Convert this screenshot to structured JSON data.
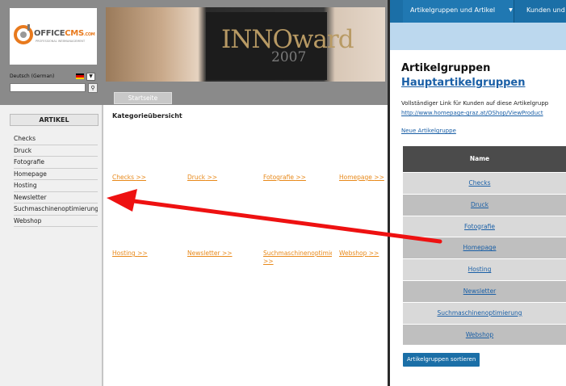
{
  "logo": {
    "brand": "OFFICE",
    "brand_accent": "CMS",
    "suffix": ".COM",
    "tagline": "PROFESSIONAL WEBMANAGEMENT"
  },
  "language": {
    "label": "Deutsch (German)",
    "dropdown_icon": "chevron-down-icon",
    "flag_colors": [
      "#000000",
      "#dd0000",
      "#ffce00"
    ]
  },
  "search": {
    "placeholder": "",
    "button_icon": "search-icon"
  },
  "banner": {
    "text": "INNOward",
    "year": "2007"
  },
  "home_tab": "Startseite",
  "sidebar": {
    "header": "ARTIKEL",
    "items": [
      "Checks",
      "Druck",
      "Fotografie",
      "Homepage",
      "Hosting",
      "Newsletter",
      "Suchmaschinenoptimierung",
      "Webshop"
    ]
  },
  "content": {
    "heading": "Kategorieübersicht",
    "arrow": ">>",
    "categories": [
      "Checks",
      "Druck",
      "Fotografie",
      "Homepage",
      "Hosting",
      "Newsletter",
      "Suchmaschinenoptimierung",
      "Webshop"
    ]
  },
  "admin": {
    "nav": [
      "Artikelgruppen und Artikel",
      "Kunden und"
    ],
    "title": "Artikelgruppen",
    "subtitle": "Hauptartikelgruppen",
    "info": "Vollständiger Link für Kunden auf diese Artikelgrupp",
    "url": "http://www.homepage-graz.at/OShop/ViewProduct",
    "new_group": "Neue Artikelgruppe",
    "table_header": "Name",
    "groups": [
      "Checks",
      "Druck",
      "Fotografie",
      "Homepage",
      "Hosting",
      "Newsletter",
      "Suchmaschinenoptimierung",
      "Webshop"
    ],
    "sort_button": "Artikelgruppen sortieren"
  },
  "colors": {
    "accent_blue": "#1b6fa7",
    "link_orange": "#e8891a",
    "annotation_red": "#ee1111"
  }
}
